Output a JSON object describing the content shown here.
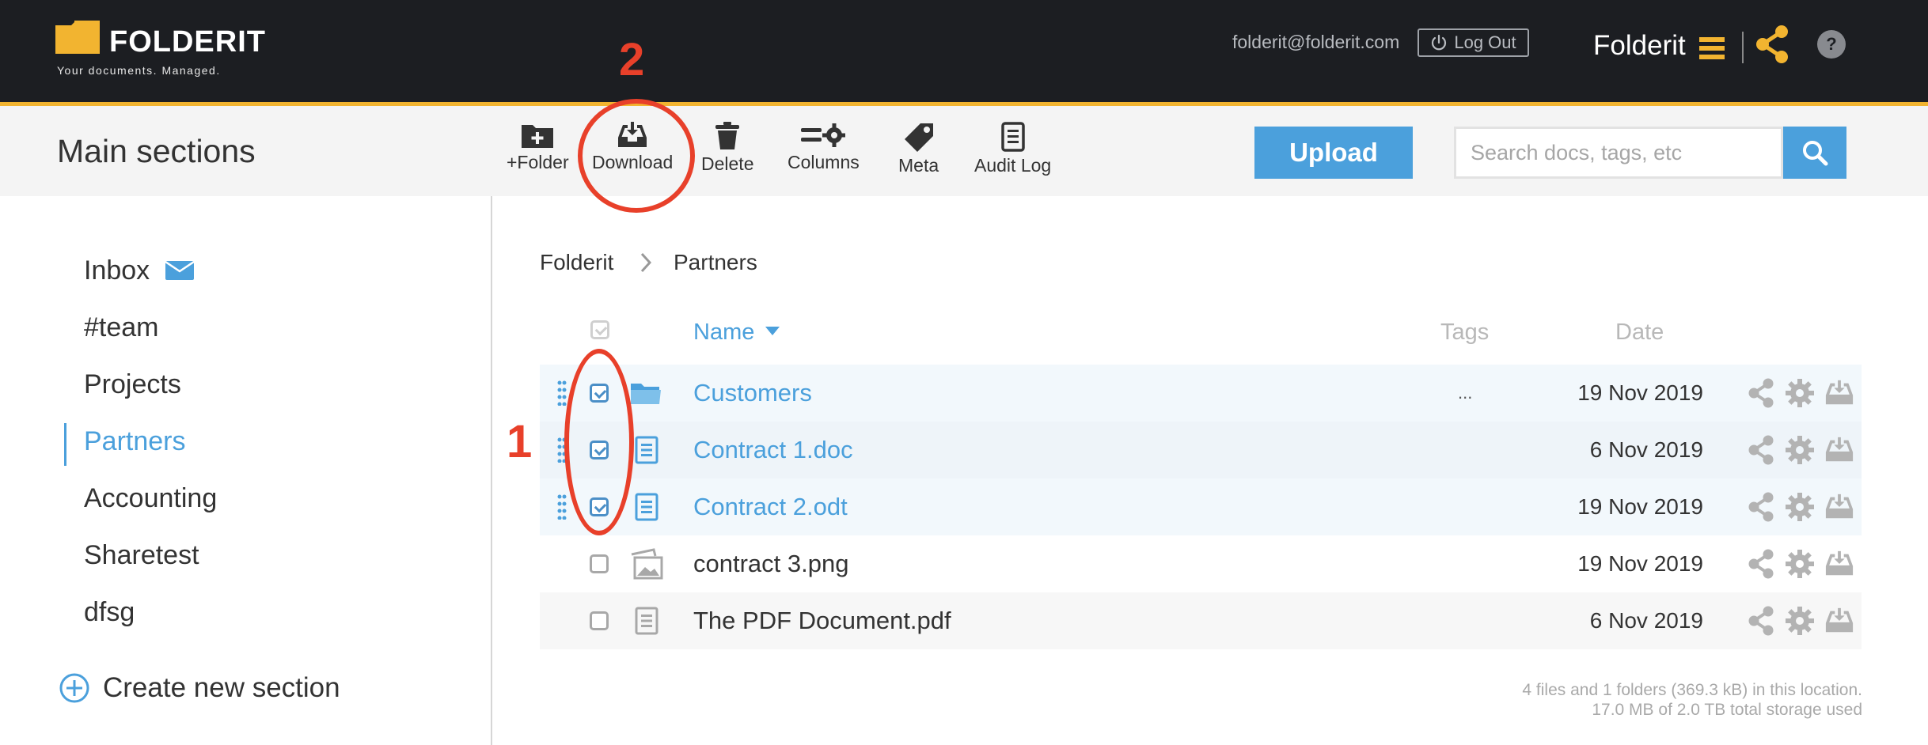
{
  "colors": {
    "topbar": "#1c1e22",
    "accent_yellow": "#f2b430",
    "primary_blue": "#4ba0dc",
    "annotation_red": "#e8402a"
  },
  "header": {
    "logo_text": "FOLDERIT",
    "logo_tagline": "Your documents. Managed.",
    "user_email": "folderit@folderit.com",
    "logout_label": "Log Out",
    "brand": "Folderit",
    "help_label": "?"
  },
  "toolbar": {
    "section_title": "Main sections",
    "tools": {
      "add_folder": "+Folder",
      "download": "Download",
      "delete": "Delete",
      "columns": "Columns",
      "meta": "Meta",
      "audit_log": "Audit Log"
    },
    "upload_label": "Upload",
    "search_placeholder": "Search docs, tags, etc"
  },
  "sidebar": {
    "items": [
      {
        "label": "Inbox",
        "icon": "envelope-icon"
      },
      {
        "label": "#team"
      },
      {
        "label": "Projects"
      },
      {
        "label": "Partners",
        "active": true
      },
      {
        "label": "Accounting"
      },
      {
        "label": "Sharetest"
      },
      {
        "label": "dfsg"
      }
    ],
    "create_label": "Create new section"
  },
  "breadcrumb": {
    "root": "Folderit",
    "current": "Partners"
  },
  "table": {
    "columns": {
      "name": "Name",
      "tags": "Tags",
      "date": "Date"
    },
    "sort": "name-descending",
    "rows": [
      {
        "name": "Customers",
        "type": "folder",
        "tags": "...",
        "date": "19 Nov 2019",
        "checked": true
      },
      {
        "name": "Contract 1.doc",
        "type": "document",
        "tags": "",
        "date": "6 Nov 2019",
        "checked": true
      },
      {
        "name": "Contract 2.odt",
        "type": "document",
        "tags": "",
        "date": "19 Nov 2019",
        "checked": true
      },
      {
        "name": "contract 3.png",
        "type": "image",
        "tags": "",
        "date": "19 Nov 2019",
        "checked": false
      },
      {
        "name": "The PDF Document.pdf",
        "type": "document",
        "tags": "",
        "date": "6 Nov 2019",
        "checked": false
      }
    ]
  },
  "footer": {
    "line1": "4 files and 1 folders (369.3 kB) in this location.",
    "line2": "17.0 MB of 2.0 TB total storage used"
  },
  "annotations": {
    "step1": "1",
    "step2": "2"
  }
}
